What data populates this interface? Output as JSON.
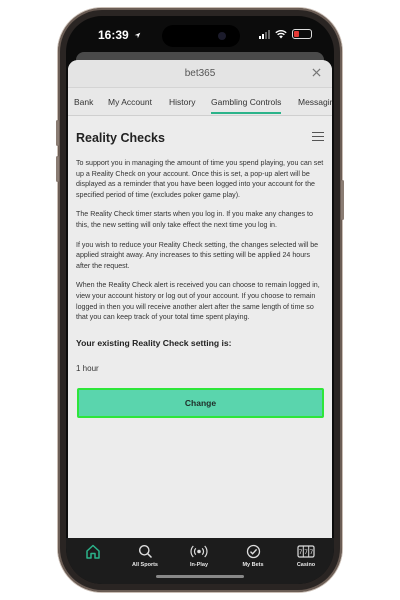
{
  "status_bar": {
    "time": "16:39"
  },
  "window": {
    "title": "bet365"
  },
  "tabs": [
    {
      "label": "Bank"
    },
    {
      "label": "My Account"
    },
    {
      "label": "History"
    },
    {
      "label": "Gambling Controls",
      "active": true
    },
    {
      "label": "Messaging"
    }
  ],
  "page": {
    "heading": "Reality Checks",
    "paragraphs": [
      "To support you in managing the amount of time you spend playing, you can set up a Reality Check on your account. Once this is set, a pop-up alert will be displayed as a reminder that you have been logged into your account for the specified period of time (excludes poker game play).",
      "The Reality Check timer starts when you log in. If you make any changes to this, the new setting will only take effect the next time you log in.",
      "If you wish to reduce your Reality Check setting, the changes selected will be applied straight away. Any increases to this setting will be applied 24 hours after the request.",
      "When the Reality Check alert is received you can choose to remain logged in, view your account history or log out of your account. If you choose to remain logged in then you will receive another alert after the same length of time so that you can keep track of your total time spent playing."
    ],
    "setting_label": "Your existing Reality Check setting is:",
    "setting_value": "1 hour",
    "change_button": "Change"
  },
  "nav": [
    {
      "icon": "home-icon",
      "label": ""
    },
    {
      "icon": "search-icon",
      "label": "All Sports"
    },
    {
      "icon": "in-play-icon",
      "label": "In-Play"
    },
    {
      "icon": "my-bets-icon",
      "label": "My Bets"
    },
    {
      "icon": "casino-icon",
      "label": "Casino"
    }
  ],
  "colors": {
    "accent": "#5ad5ad",
    "active_border": "#2ee63a",
    "nav_active": "#2bb38a",
    "battery_low": "#e53935"
  }
}
